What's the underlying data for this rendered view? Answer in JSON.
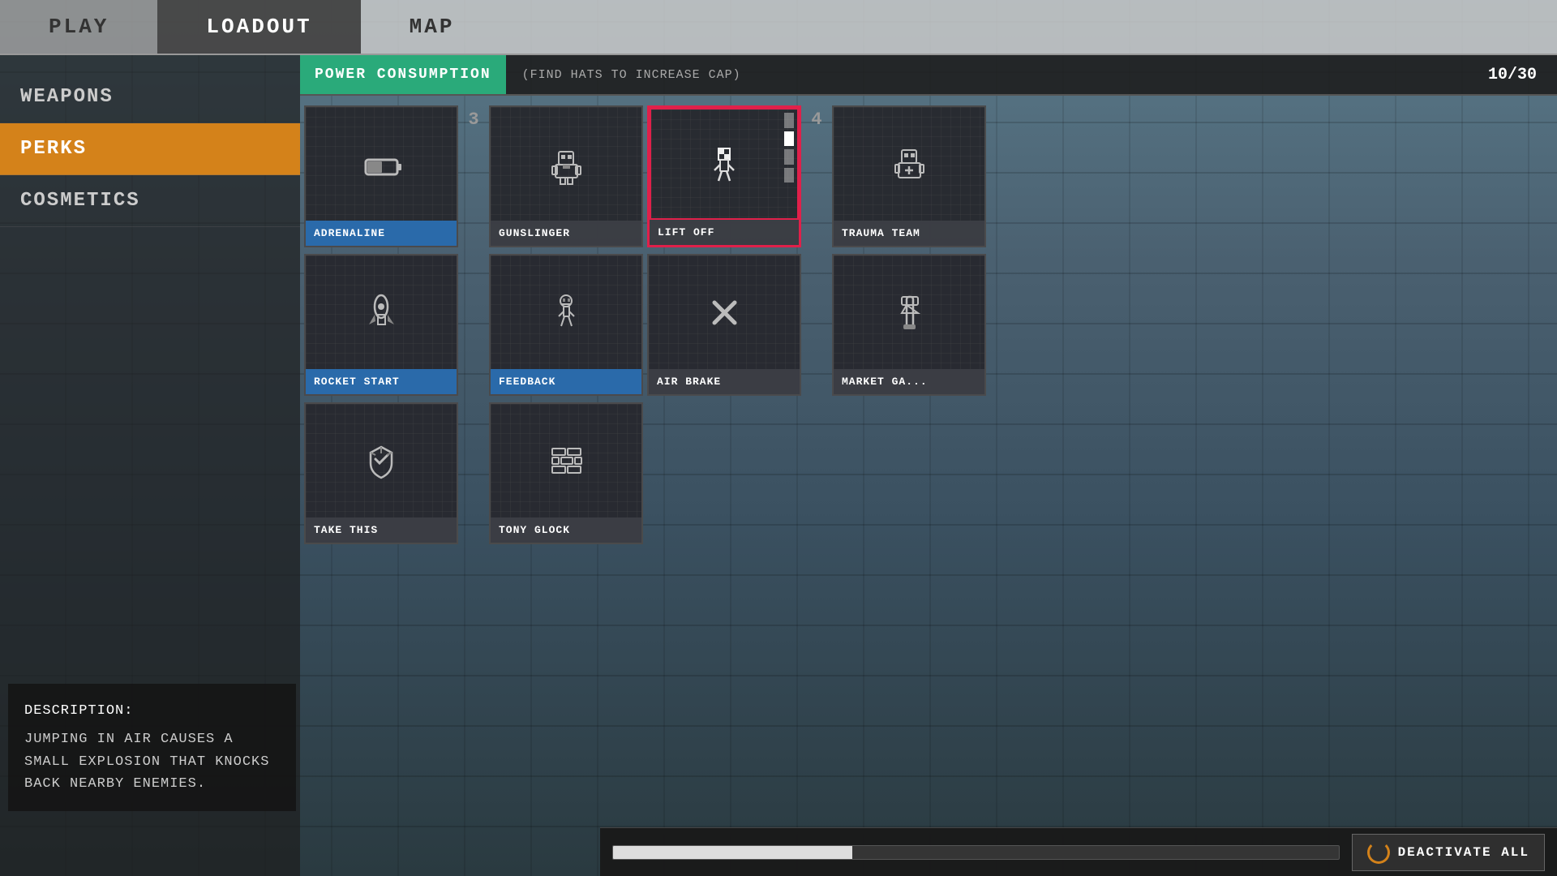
{
  "nav": {
    "items": [
      {
        "label": "PLAY",
        "active": false
      },
      {
        "label": "LOADOUT",
        "active": true
      },
      {
        "label": "MAP",
        "active": false
      }
    ]
  },
  "sidebar": {
    "menu": [
      {
        "label": "WEAPONS",
        "active": false
      },
      {
        "label": "PERKS",
        "active": true
      },
      {
        "label": "COSMETICS",
        "active": false
      }
    ]
  },
  "description": {
    "title": "DESCRIPTION:",
    "text": "JUMPING IN AIR CAUSES A\nSMALL EXPLOSION THAT KNOCKS\nBACK NEARBY ENEMIES."
  },
  "power": {
    "label": "POWER CONSUMPTION",
    "hint": "(FIND HATS TO INCREASE CAP)",
    "current": "10",
    "max": "30",
    "display": "10/30"
  },
  "perks": {
    "col3_label": "3",
    "col4_label": "4",
    "items": [
      {
        "id": "adrenaline",
        "label": "ADRENALINE",
        "icon": "battery",
        "active": true,
        "selected": false,
        "col": 1,
        "row": 1
      },
      {
        "id": "gunslinger",
        "label": "GUNSLINGER",
        "icon": "robot",
        "active": false,
        "selected": false,
        "col": 2,
        "row": 1
      },
      {
        "id": "lift-off",
        "label": "LIFT OFF",
        "icon": "checkerboard",
        "active": false,
        "selected": true,
        "col": 3,
        "row": 1
      },
      {
        "id": "trauma-team",
        "label": "TRAUMA TEAM",
        "icon": "medic",
        "active": false,
        "selected": false,
        "col": 4,
        "row": 1
      },
      {
        "id": "rocket-start",
        "label": "ROCKET START",
        "icon": "rocket",
        "active": true,
        "selected": false,
        "col": 1,
        "row": 2
      },
      {
        "id": "feedback",
        "label": "FEEDBACK",
        "icon": "skeleton",
        "active": true,
        "selected": false,
        "col": 2,
        "row": 2
      },
      {
        "id": "air-brake",
        "label": "AIR BRAKE",
        "icon": "crossbones",
        "active": false,
        "selected": false,
        "col": 3,
        "row": 2
      },
      {
        "id": "market-ga",
        "label": "MARKET GA...",
        "icon": "wrench",
        "active": false,
        "selected": false,
        "col": 4,
        "row": 2
      },
      {
        "id": "take-this",
        "label": "TAKE THIS",
        "icon": "armor",
        "active": false,
        "selected": false,
        "col": 1,
        "row": 3
      },
      {
        "id": "tony-glock",
        "label": "TONY GLOCK",
        "icon": "bricks",
        "active": false,
        "selected": false,
        "col": 2,
        "row": 3
      }
    ]
  },
  "bottom": {
    "deactivate_label": "DEACTIVATE ALL",
    "progress_pct": 33
  }
}
